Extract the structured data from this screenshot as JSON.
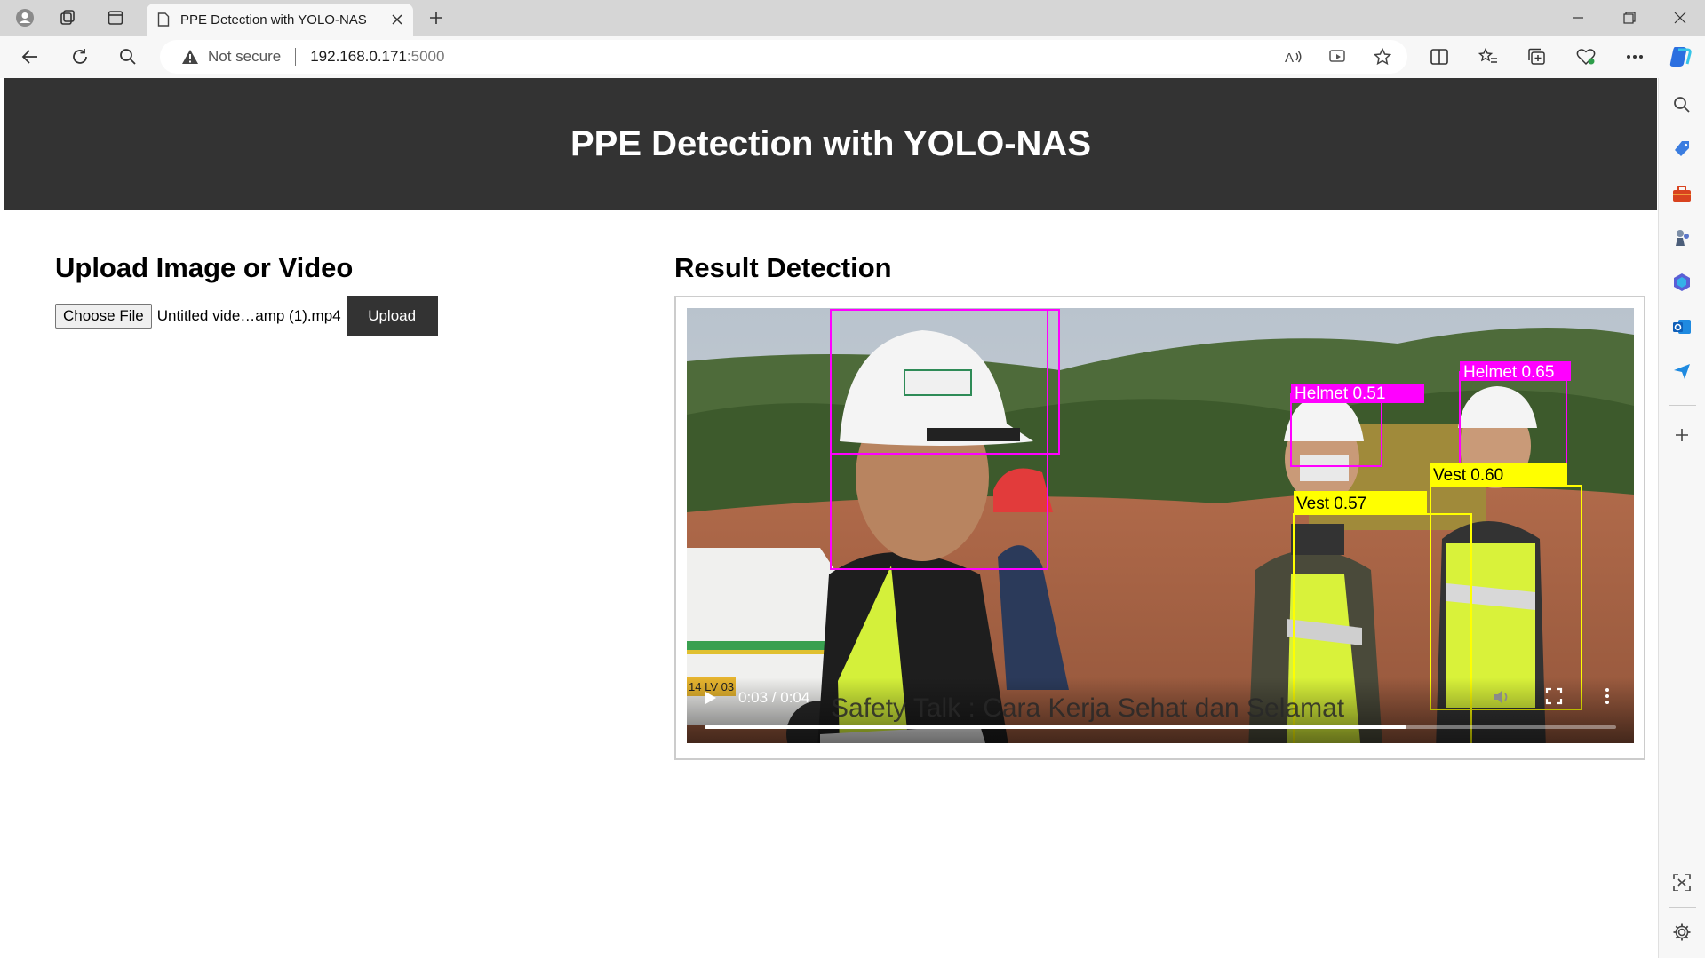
{
  "browser": {
    "tab_title": "PPE Detection with YOLO-NAS",
    "security_label": "Not secure",
    "url_host": "192.168.0.171",
    "url_port": ":5000"
  },
  "page": {
    "header_title": "PPE Detection with YOLO-NAS",
    "upload_heading": "Upload Image or Video",
    "choose_file_label": "Choose File",
    "selected_file": "Untitled vide…amp (1).mp4",
    "upload_button": "Upload",
    "result_heading": "Result Detection"
  },
  "video": {
    "time_display": "0:03 / 0:04",
    "progress": 0.77,
    "caption_text": "Safety Talk : Cara Kerja Sehat dan Selamat",
    "detections": [
      {
        "label": "Helmet 0.51",
        "color": "#ff00ff"
      },
      {
        "label": "Helmet 0.65",
        "color": "#ff00ff"
      },
      {
        "label": "Vest 0.60",
        "color": "#ffff00"
      },
      {
        "label": "Vest 0.57",
        "color": "#ffff00"
      }
    ]
  },
  "colors": {
    "header_bg": "#333333",
    "helmet_box": "#ff00ff",
    "vest_box": "#ffff00"
  }
}
